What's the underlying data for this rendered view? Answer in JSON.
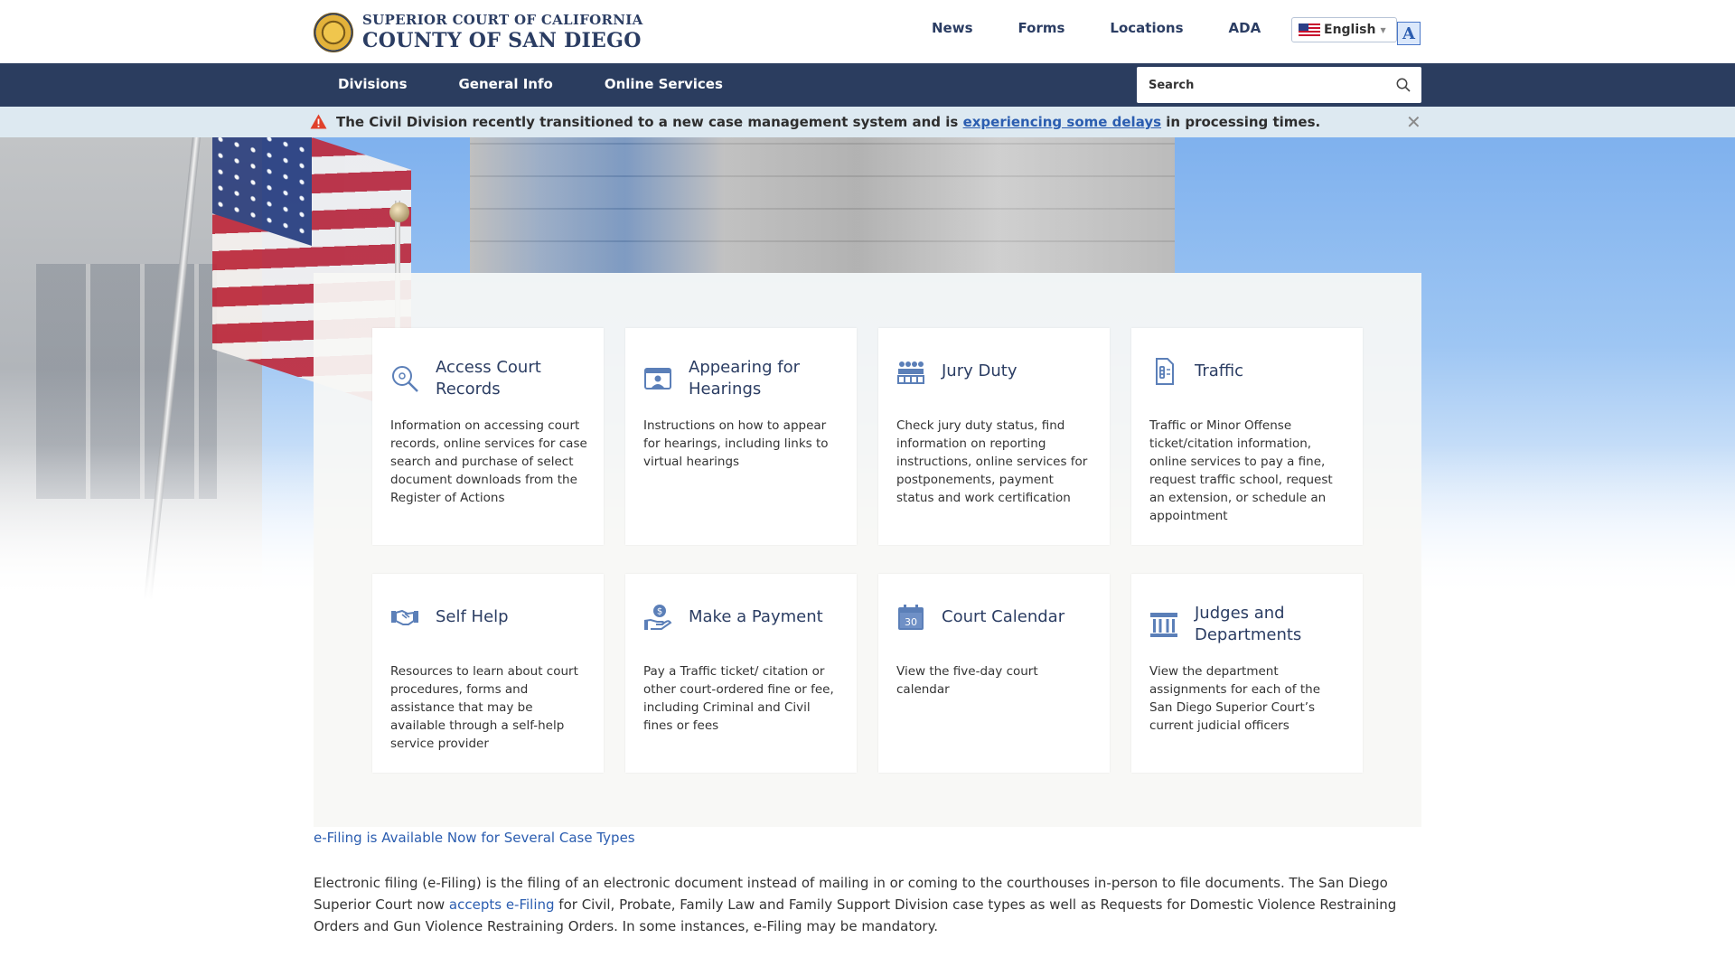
{
  "header": {
    "logo_line1": "SUPERIOR COURT OF CALIFORNIA",
    "logo_line2": "COUNTY OF SAN DIEGO",
    "topnav": [
      "News",
      "Forms",
      "Locations",
      "ADA"
    ],
    "language": "English",
    "accessibility_glyph": "A"
  },
  "nav": {
    "items": [
      "Divisions",
      "General Info",
      "Online Services"
    ],
    "search_placeholder": "Search"
  },
  "alert": {
    "text_before": "The Civil Division recently transitioned to a new case management system and is ",
    "link": "experiencing some delays",
    "text_after": " in processing times.",
    "close_glyph": "✕"
  },
  "cards": [
    {
      "icon": "magnifier-icon",
      "title": "Access Court Records",
      "desc": "Information on accessing court records, online services for case search and purchase of select document downloads from the Register of Actions"
    },
    {
      "icon": "video-hearing-icon",
      "title": "Appearing for Hearings",
      "desc": "Instructions on how to appear for hearings, including links to virtual hearings"
    },
    {
      "icon": "jury-box-icon",
      "title": "Jury Duty",
      "desc": "Check jury duty status, find information on reporting instructions, online services for postponements, payment status and work certification"
    },
    {
      "icon": "traffic-ticket-icon",
      "title": "Traffic",
      "desc": "Traffic or Minor Offense ticket/citation information, online services to pay a fine, request traffic school, request an extension, or schedule an appointment"
    },
    {
      "icon": "handshake-icon",
      "title": "Self Help",
      "desc": "Resources to learn about court procedures, forms and assistance that may be available through a self-help service provider"
    },
    {
      "icon": "payment-hand-icon",
      "title": "Make a Payment",
      "desc": "Pay a Traffic ticket/ citation or other court-ordered fine or fee, including Criminal and Civil fines or fees"
    },
    {
      "icon": "calendar-icon",
      "title": "Court Calendar",
      "desc": "View the five-day court calendar",
      "calendar_day": "30"
    },
    {
      "icon": "courthouse-icon",
      "title": "Judges and Departments",
      "desc": "View the department assignments for each of the San Diego Superior Court’s current judicial officers"
    }
  ],
  "efile": {
    "title": "e-Filing is Available Now for Several Case Types",
    "para_before": "Electronic filing (e-Filing) is the filing of an electronic document instead of mailing in or coming to the courthouses in-person to file documents. The San Diego Superior Court now ",
    "para_link": "accepts e-Filing",
    "para_after": " for Civil, Probate, Family Law and Family Support Division case types as well as Requests for Domestic Violence Restraining Orders and Gun Violence Restraining Orders. In some instances, e-Filing may be mandatory."
  },
  "colors": {
    "navy": "#2b3d5f",
    "brand_text": "#2b3d63",
    "link": "#2b5db0",
    "alert_bg": "#dde9f1",
    "icon": "#5b7fb8"
  }
}
